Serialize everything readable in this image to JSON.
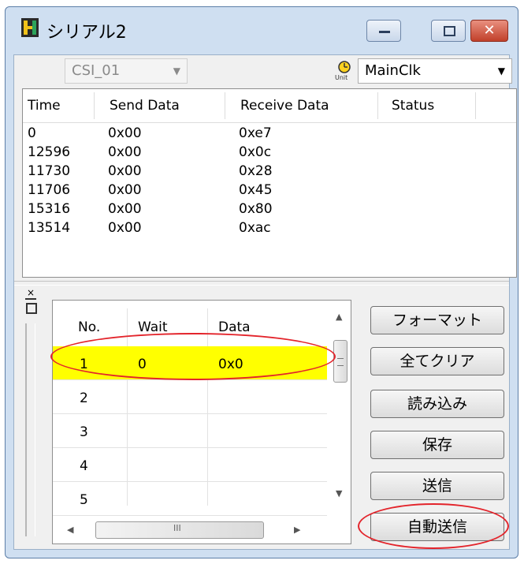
{
  "window": {
    "title": "シリアル2"
  },
  "toolbar": {
    "channel_select": "CSI_01",
    "clock_icon_label": "Unit",
    "clock_select": "MainClk"
  },
  "log_table": {
    "headers": [
      "Time",
      "Send Data",
      "Receive Data",
      "Status"
    ],
    "rows": [
      {
        "time": "0",
        "send": "0x00",
        "receive": "0xe7"
      },
      {
        "time": "12596",
        "send": "0x00",
        "receive": "0x0c"
      },
      {
        "time": "11730",
        "send": "0x00",
        "receive": "0x28"
      },
      {
        "time": "11706",
        "send": "0x00",
        "receive": "0x45"
      },
      {
        "time": "15316",
        "send": "0x00",
        "receive": "0x80"
      },
      {
        "time": "13514",
        "send": "0x00",
        "receive": "0xac"
      }
    ]
  },
  "send_grid": {
    "headers": [
      "No.",
      "Wait",
      "Data"
    ],
    "rows": [
      {
        "no": "1",
        "wait": "0",
        "data": "0x0"
      },
      {
        "no": "2",
        "wait": "",
        "data": ""
      },
      {
        "no": "3",
        "wait": "",
        "data": ""
      },
      {
        "no": "4",
        "wait": "",
        "data": ""
      },
      {
        "no": "5",
        "wait": "",
        "data": ""
      }
    ],
    "hscroll_thumb_label": "III"
  },
  "buttons": {
    "format": "フォーマット",
    "clear_all": "全てクリア",
    "load": "読み込み",
    "save": "保存",
    "send": "送信",
    "auto_send": "自動送信"
  },
  "colors": {
    "selection": "#ffff00",
    "annotation": "#e3242b",
    "window_frame": "#cfdff1"
  }
}
